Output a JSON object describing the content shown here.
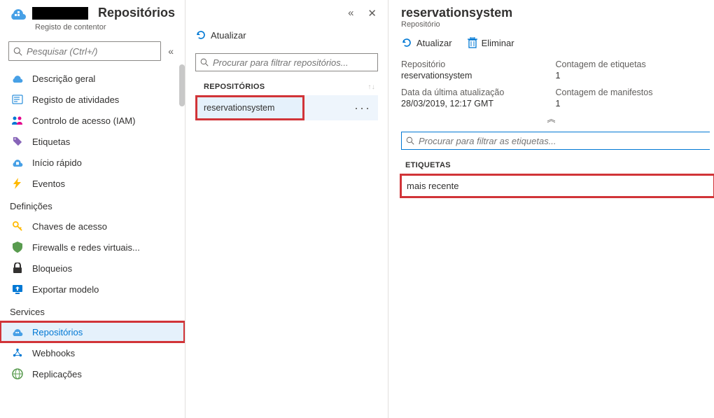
{
  "sidebar": {
    "title": "Repositórios",
    "subtitle": "Registo de contentor",
    "search_placeholder": "Pesquisar (Ctrl+/)",
    "groups": [
      {
        "label": null,
        "items": [
          {
            "id": "overview",
            "label": "Descrição geral"
          },
          {
            "id": "activity",
            "label": "Registo de atividades"
          },
          {
            "id": "iam",
            "label": "Controlo de acesso (IAM)"
          },
          {
            "id": "tags",
            "label": "Etiquetas"
          },
          {
            "id": "quickstart",
            "label": "Início rápido"
          },
          {
            "id": "events",
            "label": "Eventos"
          }
        ]
      },
      {
        "label": "Definições",
        "items": [
          {
            "id": "keys",
            "label": "Chaves de acesso"
          },
          {
            "id": "firewall",
            "label": "Firewalls e redes virtuais..."
          },
          {
            "id": "locks",
            "label": "Bloqueios"
          },
          {
            "id": "export",
            "label": "Exportar modelo"
          }
        ]
      },
      {
        "label": "Services",
        "items": [
          {
            "id": "repos",
            "label": "Repositórios"
          },
          {
            "id": "webhooks",
            "label": "Webhooks"
          },
          {
            "id": "replications",
            "label": "Replicações"
          }
        ]
      }
    ]
  },
  "mid": {
    "refresh": "Atualizar",
    "filter_placeholder": "Procurar para filtrar repositórios...",
    "section": "REPOSITÓRIOS",
    "rows": [
      {
        "name": "reservationsystem"
      }
    ]
  },
  "detail": {
    "title": "reservationsystem",
    "subtitle": "Repositório",
    "refresh": "Atualizar",
    "delete": "Eliminar",
    "meta": {
      "repo_label": "Repositório",
      "repo_value": "reservationsystem",
      "tagcount_label": "Contagem de etiquetas",
      "tagcount_value": "1",
      "updated_label": "Data da última atualização",
      "updated_value": "28/03/2019, 12:17 GMT",
      "manifest_label": "Contagem de manifestos",
      "manifest_value": "1"
    },
    "tag_filter_placeholder": "Procurar para filtrar as etiquetas...",
    "tag_section": "ETIQUETAS",
    "tags": [
      {
        "name": "mais recente"
      }
    ]
  }
}
